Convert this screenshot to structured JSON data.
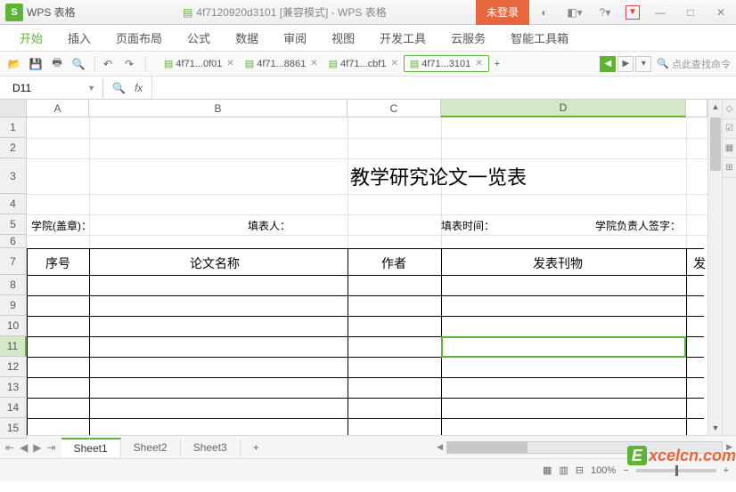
{
  "app": {
    "logo": "S",
    "name": "WPS 表格",
    "doc_title": "4f7120920d3101 [兼容模式] - WPS 表格",
    "login": "未登录"
  },
  "menu": {
    "start": "开始",
    "insert": "插入",
    "layout": "页面布局",
    "formula": "公式",
    "data": "数据",
    "review": "审阅",
    "view": "视图",
    "dev": "开发工具",
    "cloud": "云服务",
    "smart": "智能工具箱"
  },
  "file_tabs": {
    "t1": "4f71...0f01",
    "t2": "4f71...8861",
    "t3": "4f71...cbf1",
    "t4": "4f71...3101"
  },
  "search_placeholder": "点此查找命令",
  "namebox": "D11",
  "fx": "fx",
  "columns": {
    "A": "A",
    "B": "B",
    "C": "C",
    "D": "D"
  },
  "rows": {
    "r1": "1",
    "r2": "2",
    "r3": "3",
    "r4": "4",
    "r5": "5",
    "r6": "6",
    "r7": "7",
    "r8": "8",
    "r9": "9",
    "r10": "10",
    "r11": "11",
    "r12": "12",
    "r13": "13",
    "r14": "14",
    "r15": "15"
  },
  "content": {
    "title": "教学研究论文一览表",
    "label1": "学院(盖章)：",
    "label2": "填表人：",
    "label3": "填表时间：",
    "label4": "学院负责人签字：",
    "h1": "序号",
    "h2": "论文名称",
    "h3": "作者",
    "h4": "发表刊物",
    "h5": "发"
  },
  "sheets": {
    "s1": "Sheet1",
    "s2": "Sheet2",
    "s3": "Sheet3"
  },
  "status": {
    "zoom": "100%"
  },
  "watermark": {
    "e": "E",
    "rest": "xcelcn.com"
  }
}
